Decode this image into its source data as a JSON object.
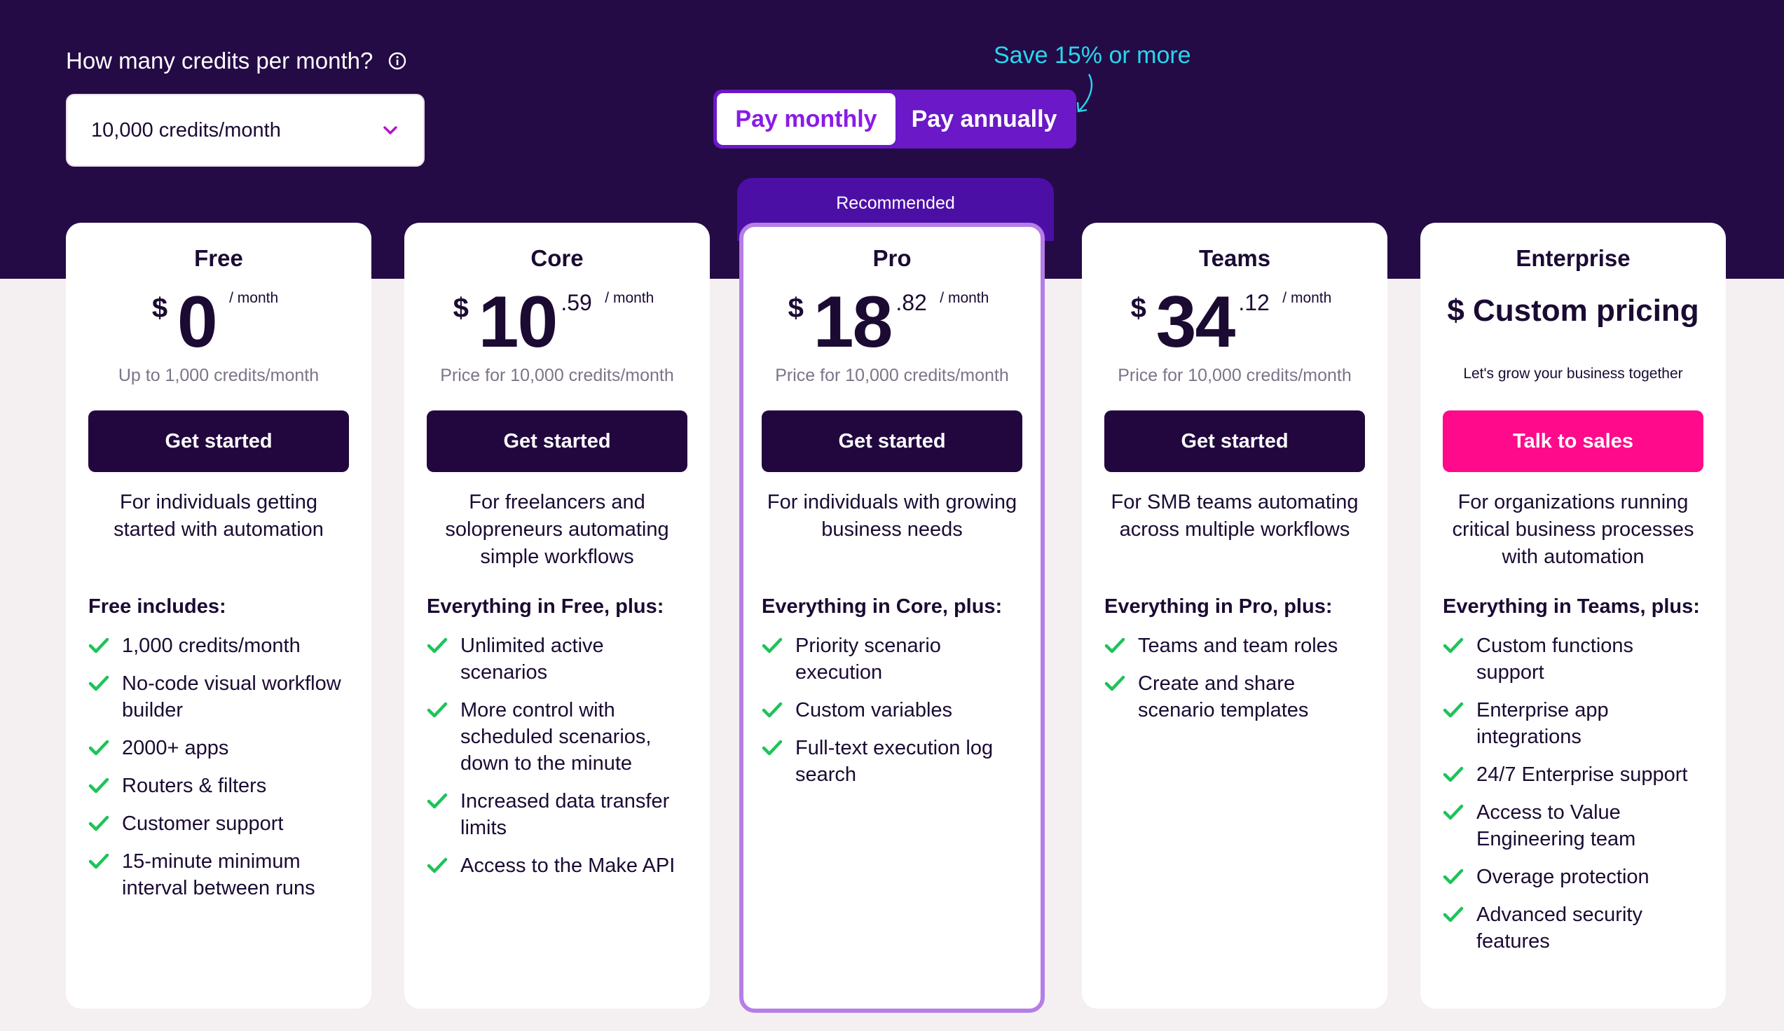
{
  "credits": {
    "question": "How many credits per month?",
    "selected": "10,000 credits/month"
  },
  "billing": {
    "save_note": "Save 15% or more",
    "monthly_label": "Pay monthly",
    "annual_label": "Pay annually"
  },
  "recommended_label": "Recommended",
  "plans": [
    {
      "name": "Free",
      "currency": "$",
      "whole": "0",
      "cents": "",
      "per": "/ month",
      "note": "Up to 1,000 credits/month",
      "cta": "Get started",
      "description": "For individuals getting started with automation",
      "includes_title": "Free includes:",
      "features": [
        "1,000 credits/month",
        "No-code visual workflow builder",
        "2000+ apps",
        "Routers & filters",
        "Customer support",
        "15-minute minimum interval between runs"
      ]
    },
    {
      "name": "Core",
      "currency": "$",
      "whole": "10",
      "cents": ".59",
      "per": "/ month",
      "note": "Price for 10,000 credits/month",
      "cta": "Get started",
      "description": "For freelancers and solopreneurs automating simple workflows",
      "includes_title": "Everything in Free, plus:",
      "features": [
        "Unlimited active scenarios",
        "More control with scheduled scenarios, down to the minute",
        "Increased data transfer limits",
        "Access to the Make API"
      ]
    },
    {
      "name": "Pro",
      "currency": "$",
      "whole": "18",
      "cents": ".82",
      "per": "/ month",
      "note": "Price for 10,000 credits/month",
      "cta": "Get started",
      "description": "For individuals with growing business needs",
      "includes_title": "Everything in Core, plus:",
      "features": [
        "Priority scenario execution",
        "Custom variables",
        "Full-text execution log search"
      ]
    },
    {
      "name": "Teams",
      "currency": "$",
      "whole": "34",
      "cents": ".12",
      "per": "/ month",
      "note": "Price for 10,000 credits/month",
      "cta": "Get started",
      "description": "For SMB teams automating across multiple workflows",
      "includes_title": "Everything in Pro, plus:",
      "features": [
        "Teams and team roles",
        "Create and share scenario templates"
      ]
    },
    {
      "name": "Enterprise",
      "custom_price": "$ Custom pricing",
      "note": "Let's grow your business together",
      "cta": "Talk to sales",
      "description": "For organizations running critical business processes with automation",
      "includes_title": "Everything in Teams, plus:",
      "features": [
        "Custom functions support",
        "Enterprise app integrations",
        "24/7 Enterprise support",
        "Access to Value Engineering team",
        "Overage protection",
        "Advanced security features"
      ]
    }
  ],
  "colors": {
    "hero": "#240b45",
    "accent_purple": "#8a1be6",
    "cta_dark": "#22073f",
    "cta_pink": "#ff0a8a",
    "check_green": "#1ec35a",
    "save_cyan": "#27d7ee"
  }
}
